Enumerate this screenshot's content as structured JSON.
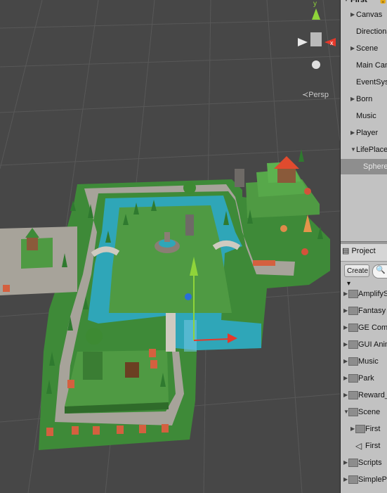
{
  "scene_view": {
    "persp_label": "≺Persp",
    "gizmo_axes": {
      "y": "y",
      "x": "x"
    }
  },
  "hierarchy": {
    "root_label": "First",
    "items": [
      {
        "label": "Canvas",
        "expandable": true
      },
      {
        "label": "Directional",
        "expandable": false
      },
      {
        "label": "Scene",
        "expandable": true
      },
      {
        "label": "Main Camer",
        "expandable": false
      },
      {
        "label": "EventSyster",
        "expandable": false
      },
      {
        "label": "Born",
        "expandable": true
      },
      {
        "label": "Music",
        "expandable": false
      },
      {
        "label": "Player",
        "expandable": true
      },
      {
        "label": "LifePlace",
        "expandable": true,
        "expanded": true
      },
      {
        "label": "Sphere",
        "expandable": false,
        "selected": true
      }
    ]
  },
  "project": {
    "tab_label": "Project",
    "create_label": "Create ▾",
    "search_placeholder": "🔍",
    "folders": [
      {
        "label": "AmplifySha",
        "expanded": false
      },
      {
        "label": "Fantasy Sk",
        "expanded": false
      },
      {
        "label": "GE Commo",
        "expanded": false
      },
      {
        "label": "GUI Anima",
        "expanded": false
      },
      {
        "label": "Music",
        "expanded": false
      },
      {
        "label": "Park",
        "expanded": false
      },
      {
        "label": "Reward_ar",
        "expanded": false
      },
      {
        "label": "Scene",
        "expanded": true
      },
      {
        "label": "First",
        "child": true,
        "type": "folder"
      },
      {
        "label": "First",
        "child": true,
        "type": "unity-scene"
      },
      {
        "label": "Scripts",
        "expanded": false
      },
      {
        "label": "SimplePeop",
        "expanded": false
      }
    ]
  },
  "colors": {
    "scene_bg": "#474747",
    "grass": "#4f9a43",
    "water": "#2fa6b8",
    "path": "#a7a39a",
    "panel_bg": "#c2c2c2",
    "selection": "#8e8e8e",
    "gizmo_x": "#e5382a",
    "gizmo_y": "#8fd43a"
  }
}
